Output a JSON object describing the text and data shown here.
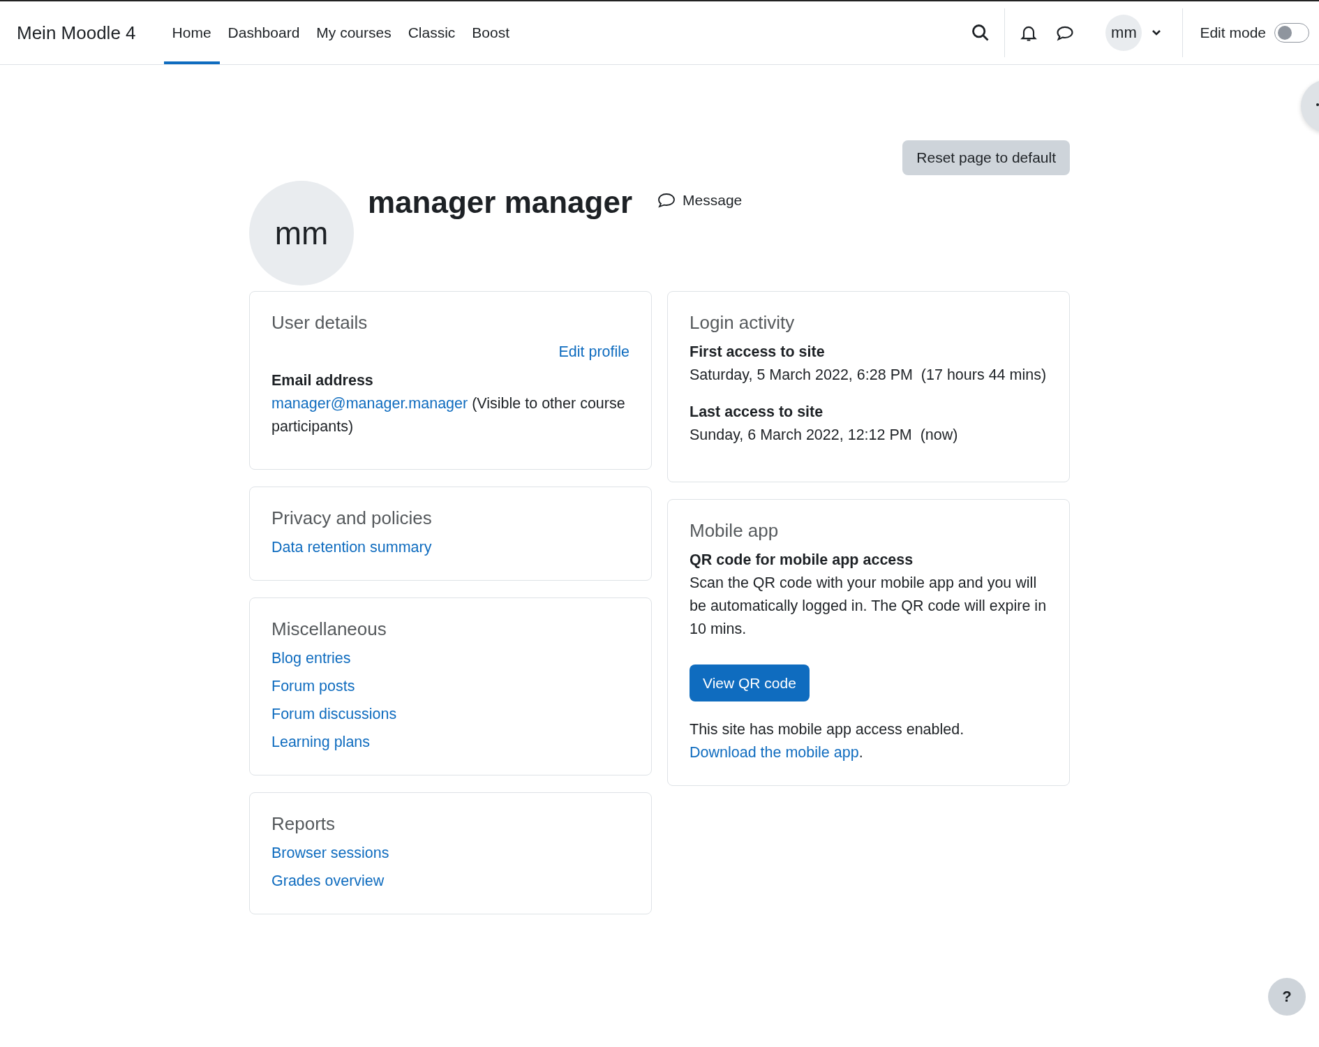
{
  "navbar": {
    "brand": "Mein Moodle 4",
    "links": [
      {
        "label": "Home",
        "selected": true
      },
      {
        "label": "Dashboard",
        "selected": false
      },
      {
        "label": "My courses",
        "selected": false
      },
      {
        "label": "Classic",
        "selected": false
      },
      {
        "label": "Boost",
        "selected": false
      }
    ],
    "user_initials": "mm",
    "edit_mode": {
      "label": "Edit mode",
      "on": false
    }
  },
  "reset_button": "Reset page to default",
  "profile": {
    "initials": "mm",
    "name": "manager manager",
    "message": "Message"
  },
  "user_details": {
    "title": "User details",
    "edit_link": "Edit profile",
    "field_label": "Email address",
    "email": "manager@manager.manager",
    "email_note": "(Visible to other course participants)"
  },
  "left_cards": [
    {
      "title": "Privacy and policies",
      "links": [
        "Data retention summary"
      ]
    },
    {
      "title": "Miscellaneous",
      "links": [
        "Blog entries",
        "Forum posts",
        "Forum discussions",
        "Learning plans"
      ]
    },
    {
      "title": "Reports",
      "links": [
        "Browser sessions",
        "Grades overview"
      ]
    }
  ],
  "login_activity": {
    "title": "Login activity",
    "items": [
      {
        "label": "First access to site",
        "value": "Saturday, 5 March 2022, 6:28 PM  (17 hours 44 mins)"
      },
      {
        "label": "Last access to site",
        "value": "Sunday, 6 March 2022, 12:12 PM  (now)"
      }
    ]
  },
  "mobile_app": {
    "title": "Mobile app",
    "heading": "QR code for mobile app access",
    "text": "Scan the QR code with your mobile app and you will be automatically logged in. The QR code will expire in 10 mins.",
    "button": "View QR code",
    "note": "This site has mobile app access enabled.",
    "link": "Download the mobile app",
    "link_suffix": "."
  },
  "help": "?"
}
